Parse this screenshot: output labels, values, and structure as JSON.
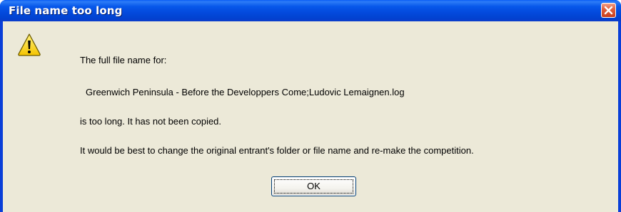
{
  "dialog": {
    "title": "File name too long",
    "close_icon": "close-icon",
    "icon": "warning-icon",
    "message": {
      "line1": "The full file name for:",
      "file_name": "Greenwich Peninsula - Before the Developpers Come;Ludovic Lemaignen.log",
      "line3": "is too long.  It has not been copied.",
      "line4": "It would be best to change the original entrant's folder or file name and re-make the competition."
    },
    "ok_label": "OK"
  },
  "colors": {
    "title_bar": "#0349dc",
    "client_bg": "#ece9d8",
    "close_button": "#e0603e",
    "warning_yellow": "#fcd935"
  }
}
